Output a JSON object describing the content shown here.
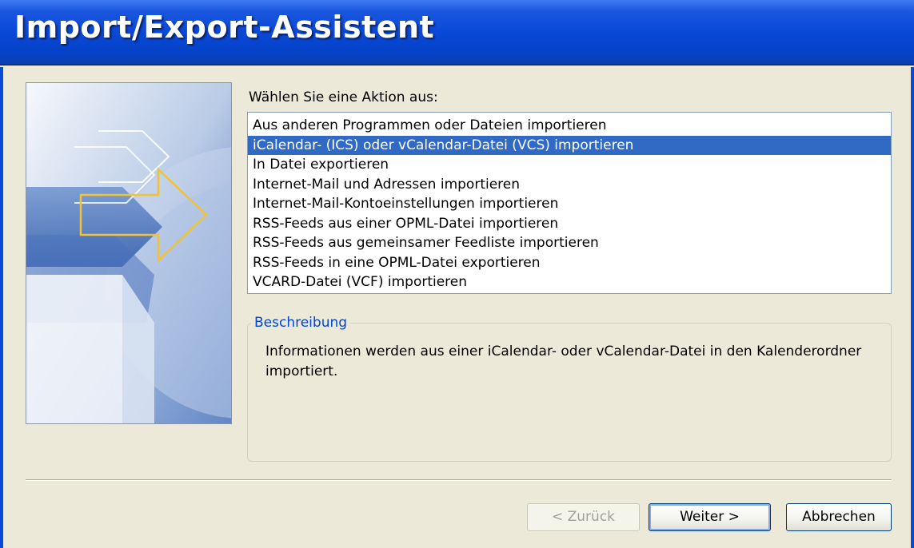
{
  "window": {
    "title": "Import/Export-Assistent"
  },
  "main": {
    "prompt": "Wählen Sie eine Aktion aus:",
    "actions": [
      {
        "label": "Aus anderen Programmen oder Dateien importieren",
        "selected": false
      },
      {
        "label": "iCalendar- (ICS) oder vCalendar-Datei (VCS) importieren",
        "selected": true
      },
      {
        "label": "In Datei exportieren",
        "selected": false
      },
      {
        "label": "Internet-Mail und Adressen importieren",
        "selected": false
      },
      {
        "label": "Internet-Mail-Kontoeinstellungen importieren",
        "selected": false
      },
      {
        "label": "RSS-Feeds aus einer OPML-Datei importieren",
        "selected": false
      },
      {
        "label": "RSS-Feeds aus gemeinsamer Feedliste importieren",
        "selected": false
      },
      {
        "label": "RSS-Feeds in eine OPML-Datei exportieren",
        "selected": false
      },
      {
        "label": "VCARD-Datei (VCF) importieren",
        "selected": false
      }
    ],
    "description": {
      "legend": "Beschreibung",
      "text": "Informationen werden aus einer iCalendar- oder vCalendar-Datei in den Kalenderordner importiert."
    }
  },
  "buttons": {
    "back": "< Zurück",
    "next": "Weiter >",
    "cancel": "Abbrechen"
  },
  "colors": {
    "title_bar": "#0a48d8",
    "selection": "#316ac5",
    "dialog_background": "#ece9d8",
    "legend_text": "#0046d5"
  },
  "icons": {
    "wizard_graphic": "arrows-graphic"
  }
}
